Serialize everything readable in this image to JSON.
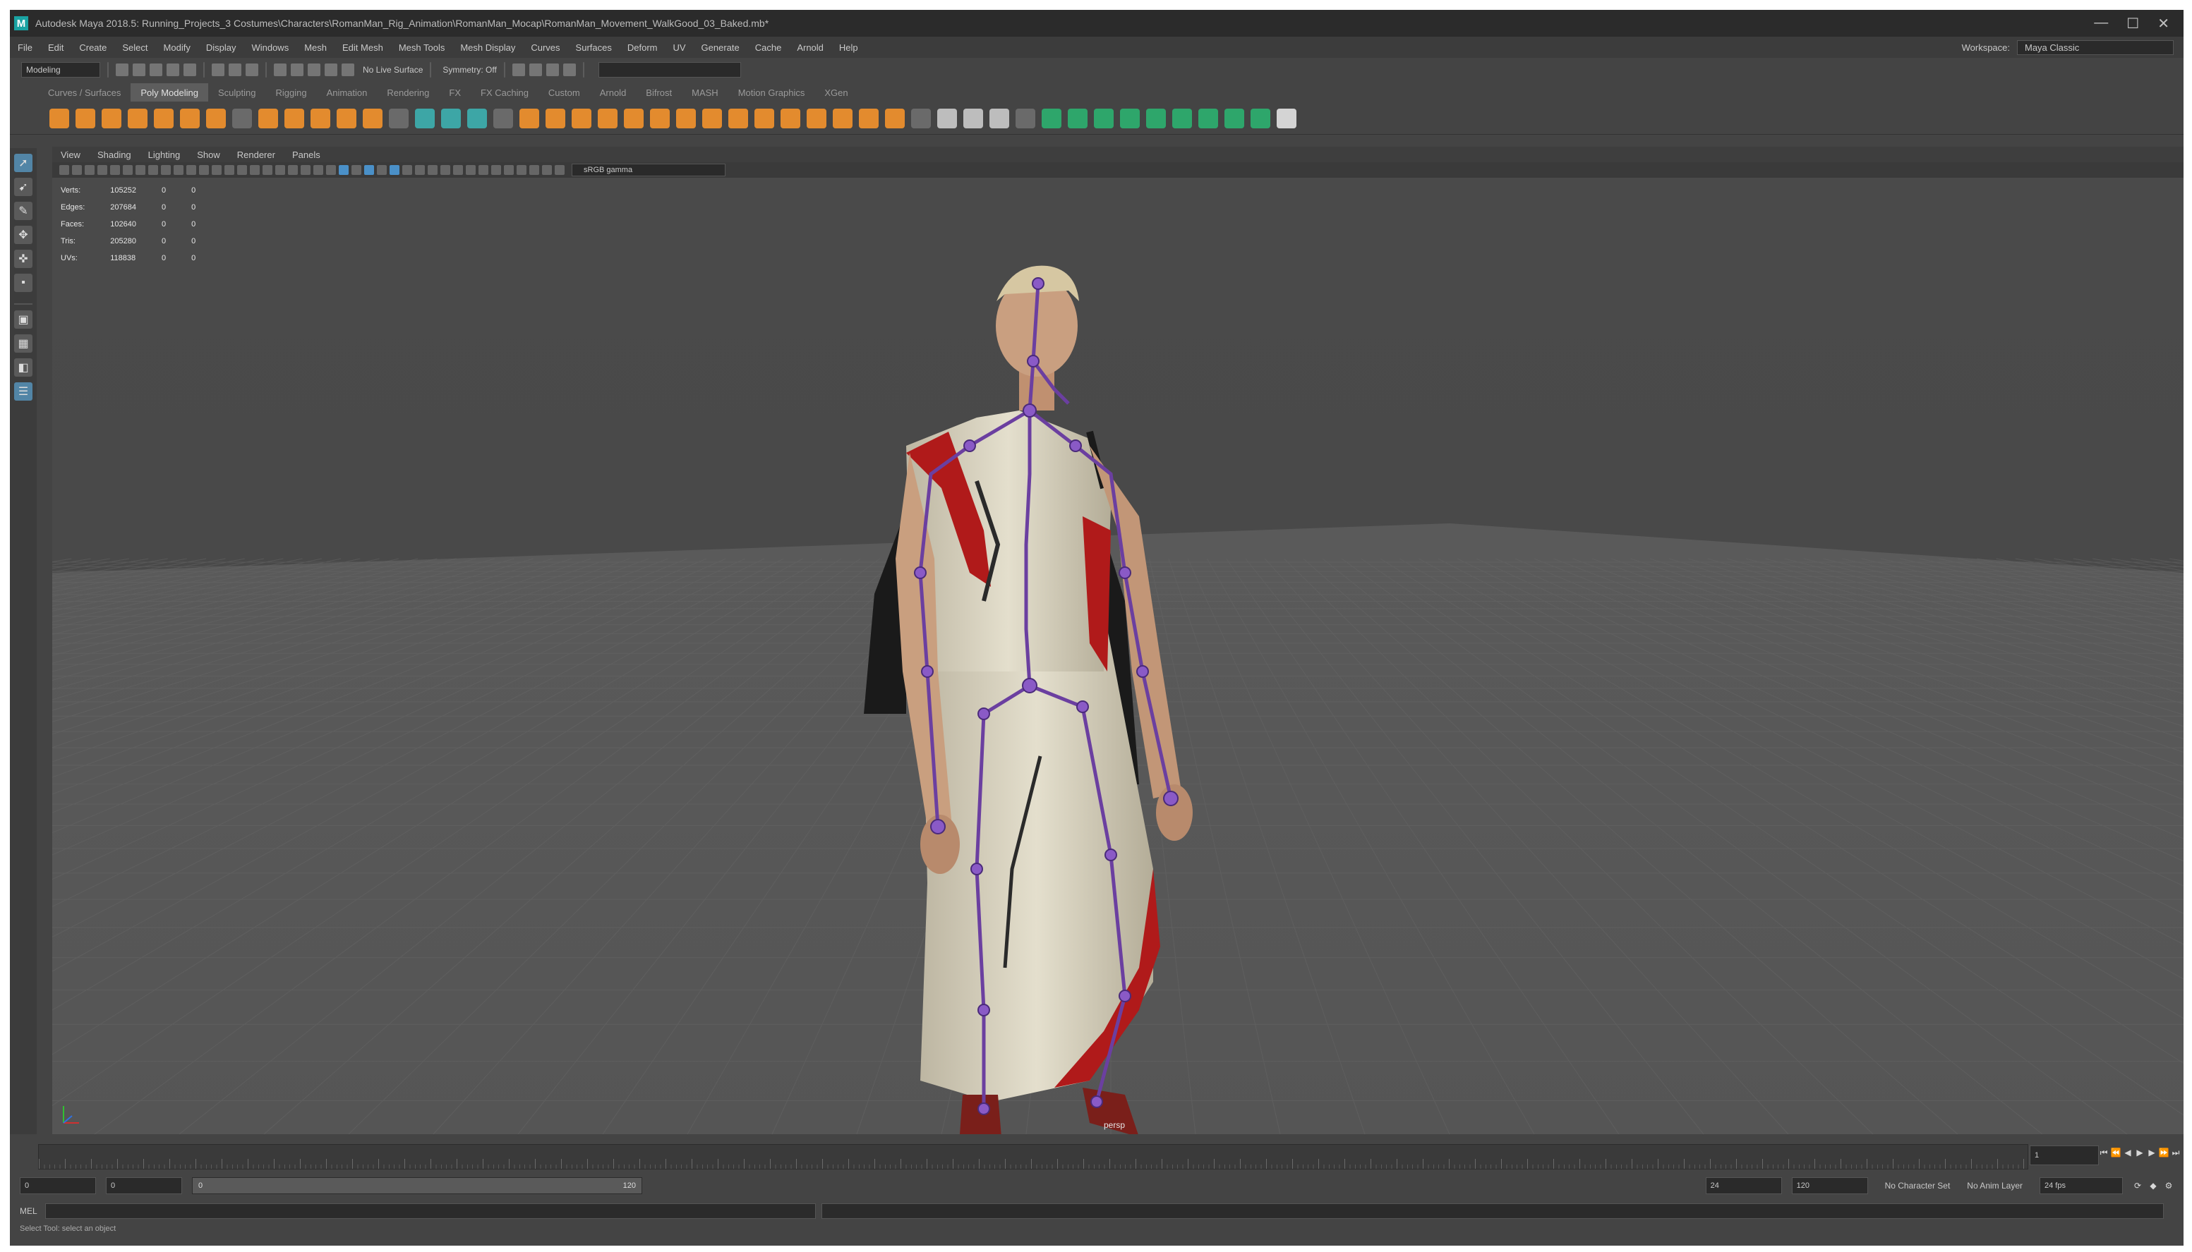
{
  "window": {
    "title": "Autodesk Maya 2018.5: Running_Projects_3 Costumes\\Characters\\RomanMan_Rig_Animation\\RomanMan_Mocap\\RomanMan_Movement_WalkGood_03_Baked.mb*",
    "controls": [
      "—",
      "☐",
      "✕"
    ]
  },
  "menubar": {
    "items": [
      "File",
      "Edit",
      "Create",
      "Select",
      "Modify",
      "Display",
      "Windows",
      "Mesh",
      "Edit Mesh",
      "Mesh Tools",
      "Mesh Display",
      "Curves",
      "Surfaces",
      "Deform",
      "UV",
      "Generate",
      "Cache",
      "Arnold",
      "Help"
    ],
    "workspace_label": "Workspace:",
    "workspace_value": "Maya Classic"
  },
  "statusline": {
    "mode": "Modeling",
    "live_surface": "No Live Surface",
    "symmetry": "Symmetry: Off"
  },
  "shelf": {
    "tabs": [
      "Curves / Surfaces",
      "Poly Modeling",
      "Sculpting",
      "Rigging",
      "Animation",
      "Rendering",
      "FX",
      "FX Caching",
      "Custom",
      "Arnold",
      "Bifrost",
      "MASH",
      "Motion Graphics",
      "XGen"
    ],
    "active_tab": 1,
    "icon_colors": [
      "#e38b2e",
      "#e38b2e",
      "#e38b2e",
      "#e38b2e",
      "#e38b2e",
      "#e38b2e",
      "#e38b2e",
      "#6a6a6a",
      "#e38b2e",
      "#e38b2e",
      "#e38b2e",
      "#e38b2e",
      "#e38b2e",
      "#6a6a6a",
      "#3da6a6",
      "#3da6a6",
      "#3da6a6",
      "#6a6a6a",
      "#e38b2e",
      "#e38b2e",
      "#e38b2e",
      "#e38b2e",
      "#e38b2e",
      "#e38b2e",
      "#e38b2e",
      "#e38b2e",
      "#e38b2e",
      "#e38b2e",
      "#e38b2e",
      "#e38b2e",
      "#e38b2e",
      "#e38b2e",
      "#e38b2e",
      "#6a6a6a",
      "#bdbdbd",
      "#bdbdbd",
      "#bdbdbd",
      "#6a6a6a",
      "#2ea66b",
      "#2ea66b",
      "#2ea66b",
      "#2ea66b",
      "#2ea66b",
      "#2ea66b",
      "#2ea66b",
      "#2ea66b",
      "#2ea66b",
      "#d4d4d4"
    ]
  },
  "panel": {
    "menus": [
      "View",
      "Shading",
      "Lighting",
      "Show",
      "Renderer",
      "Panels"
    ],
    "camera_field": "sRGB gamma"
  },
  "hud": {
    "rows": [
      {
        "label": "Verts:",
        "value": "105252",
        "sel": "0",
        "tri": "0"
      },
      {
        "label": "Edges:",
        "value": "207684",
        "sel": "0",
        "tri": "0"
      },
      {
        "label": "Faces:",
        "value": "102640",
        "sel": "0",
        "tri": "0"
      },
      {
        "label": "Tris:",
        "value": "205280",
        "sel": "0",
        "tri": "0"
      },
      {
        "label": "UVs:",
        "value": "118838",
        "sel": "0",
        "tri": "0"
      }
    ]
  },
  "viewport": {
    "camera_label": "persp"
  },
  "timeline": {
    "current_frame": "1",
    "range_start": "0",
    "range_inner_start": "0",
    "range_slider_start": "0",
    "range_slider_end": "120",
    "range_end_a": "24",
    "range_end_b": "120",
    "char_set": "No Character Set",
    "anim_layer": "No Anim Layer",
    "fps": "24 fps"
  },
  "cmdline": {
    "label": "MEL",
    "help": "Select Tool: select an object"
  },
  "colors": {
    "app_bg": "#444444",
    "viewport_bg": "#474747",
    "grid_line": "#525252",
    "toga": "#ded8c4",
    "toga_red": "#b01a1a",
    "skeleton": "#6b3fa0"
  }
}
